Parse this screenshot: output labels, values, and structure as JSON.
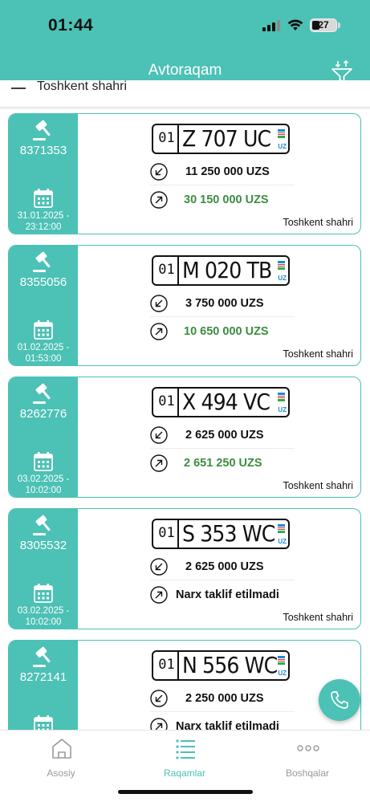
{
  "status_bar": {
    "time": "01:44",
    "battery": "27"
  },
  "header": {
    "title": "Avtoraqam",
    "subheader": "Toshkent shahri"
  },
  "colors": {
    "accent": "#4cc1b5",
    "green": "#3b8d3f",
    "flag_blue": "#1b8bd6",
    "flag_green": "#2fae4b"
  },
  "icons": {
    "lot": "gavel-icon",
    "date": "calendar-icon",
    "start_price": "arrow-down-left-icon",
    "current_price": "arrow-up-right-icon",
    "filter": "filter-icon",
    "call": "phone-icon"
  },
  "listings": [
    {
      "lot": "8371353",
      "date": "31.01.2025 - 23:12:00",
      "plate_region": "01",
      "plate_number": "Z 707 UC",
      "plate_country": "UZ",
      "start_price": "11 250 000 UZS",
      "current_price": "30 150 000 UZS",
      "region": "Toshkent shahri"
    },
    {
      "lot": "8355056",
      "date": "01.02.2025 - 01:53:00",
      "plate_region": "01",
      "plate_number": "M 020 TB",
      "plate_country": "UZ",
      "start_price": "3 750 000 UZS",
      "current_price": "10 650 000 UZS",
      "region": "Toshkent shahri"
    },
    {
      "lot": "8262776",
      "date": "03.02.2025 - 10:02:00",
      "plate_region": "01",
      "plate_number": "X 494 VC",
      "plate_country": "UZ",
      "start_price": "2 625 000 UZS",
      "current_price": "2 651 250 UZS",
      "region": "Toshkent shahri"
    },
    {
      "lot": "8305532",
      "date": "03.02.2025 - 10:02:00",
      "plate_region": "01",
      "plate_number": "S 353 WC",
      "plate_country": "UZ",
      "start_price": "2 625 000 UZS",
      "current_price": "Narx taklif etilmadi",
      "region": "Toshkent shahri"
    },
    {
      "lot": "8272141",
      "date": "",
      "plate_region": "01",
      "plate_number": "N 556 WC",
      "plate_country": "UZ",
      "start_price": "2 250 000 UZS",
      "current_price": "Narx taklif etilmadi",
      "region": ""
    }
  ],
  "tabs": [
    {
      "label": "Asosiy",
      "icon": "home-icon",
      "active": false
    },
    {
      "label": "Raqamlar",
      "icon": "list-icon",
      "active": true
    },
    {
      "label": "Boshqalar",
      "icon": "more-icon",
      "active": false
    }
  ]
}
